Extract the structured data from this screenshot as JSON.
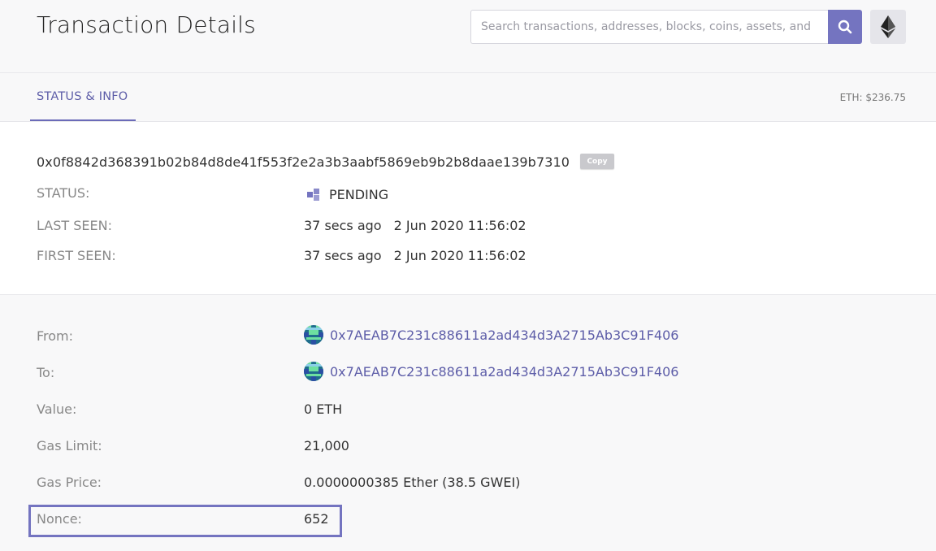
{
  "header": {
    "title": "Transaction Details",
    "search_placeholder": "Search transactions, addresses, blocks, coins, assets, and",
    "search_icon": "search-icon",
    "network_icon": "ethereum-logo-icon"
  },
  "tabs": [
    {
      "label": "STATUS & INFO",
      "active": true
    }
  ],
  "eth_price": "ETH: $236.75",
  "transaction": {
    "hash": "0x0f8842d368391b02b84d8de41f553f2e2a3b3aabf5869eb9b2b8daae139b7310",
    "copy_label": "Copy",
    "status_label": "STATUS:",
    "status_value": "PENDING",
    "last_seen_label": "LAST SEEN:",
    "last_seen_ago": "37 secs ago",
    "last_seen_date": "2 Jun 2020 11:56:02",
    "first_seen_label": "FIRST SEEN:",
    "first_seen_ago": "37 secs ago",
    "first_seen_date": "2 Jun 2020 11:56:02"
  },
  "details": {
    "from_label": "From:",
    "from_address": "0x7AEAB7C231c88611a2ad434d3A2715Ab3C91F406",
    "to_label": "To:",
    "to_address": "0x7AEAB7C231c88611a2ad434d3A2715Ab3C91F406",
    "value_label": "Value:",
    "value": "0 ETH",
    "gas_limit_label": "Gas Limit:",
    "gas_limit": "21,000",
    "gas_price_label": "Gas Price:",
    "gas_price": "0.0000000385 Ether (38.5 GWEI)",
    "nonce_label": "Nonce:",
    "nonce": "652"
  },
  "colors": {
    "accent": "#7474c0",
    "link": "#5d5da8",
    "label": "#888888",
    "highlight_border": "#7474c0"
  }
}
